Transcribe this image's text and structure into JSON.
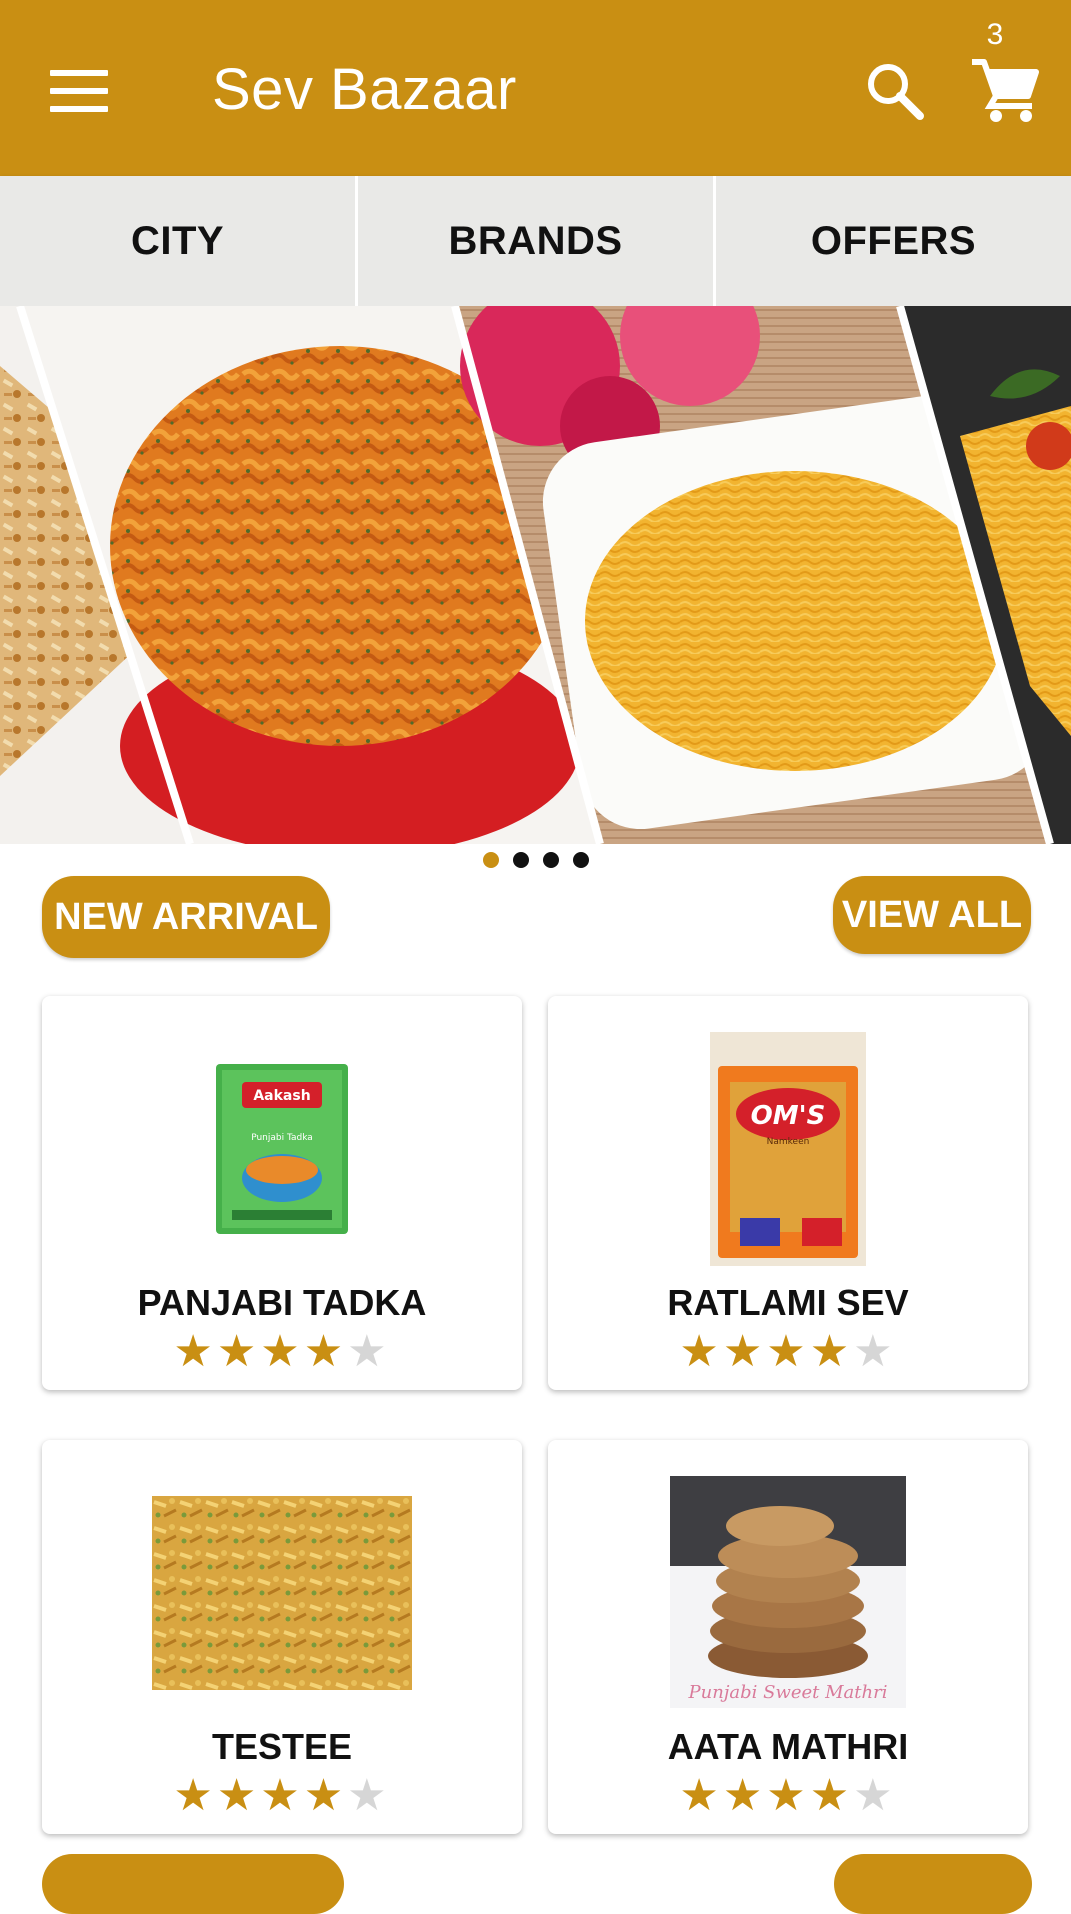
{
  "app": {
    "title": "Sev Bazaar",
    "cart_count": "3",
    "accent_color": "#c98f13"
  },
  "icons": [
    "menu-icon",
    "search-icon",
    "cart-icon"
  ],
  "tabs": [
    {
      "label": "CITY"
    },
    {
      "label": "BRANDS"
    },
    {
      "label": "OFFERS"
    }
  ],
  "banner": {
    "slides": 4,
    "active_slide": 1
  },
  "section": {
    "title": "NEW ARRIVAL",
    "view_all": "VIEW ALL"
  },
  "products": [
    {
      "name": "PANJABI TADKA",
      "rating": 4,
      "max_rating": 5,
      "package_brand": "Aakash",
      "package_text": "Punjabi Tadka"
    },
    {
      "name": "RATLAMI SEV",
      "rating": 4,
      "max_rating": 5,
      "package_brand": "OM'S",
      "package_text": "Namkeen"
    },
    {
      "name": "TESTEE",
      "rating": 4,
      "max_rating": 5
    },
    {
      "name": "AATA MATHRI",
      "rating": 4,
      "max_rating": 5,
      "image_caption": "Punjabi Sweet Mathri"
    }
  ]
}
